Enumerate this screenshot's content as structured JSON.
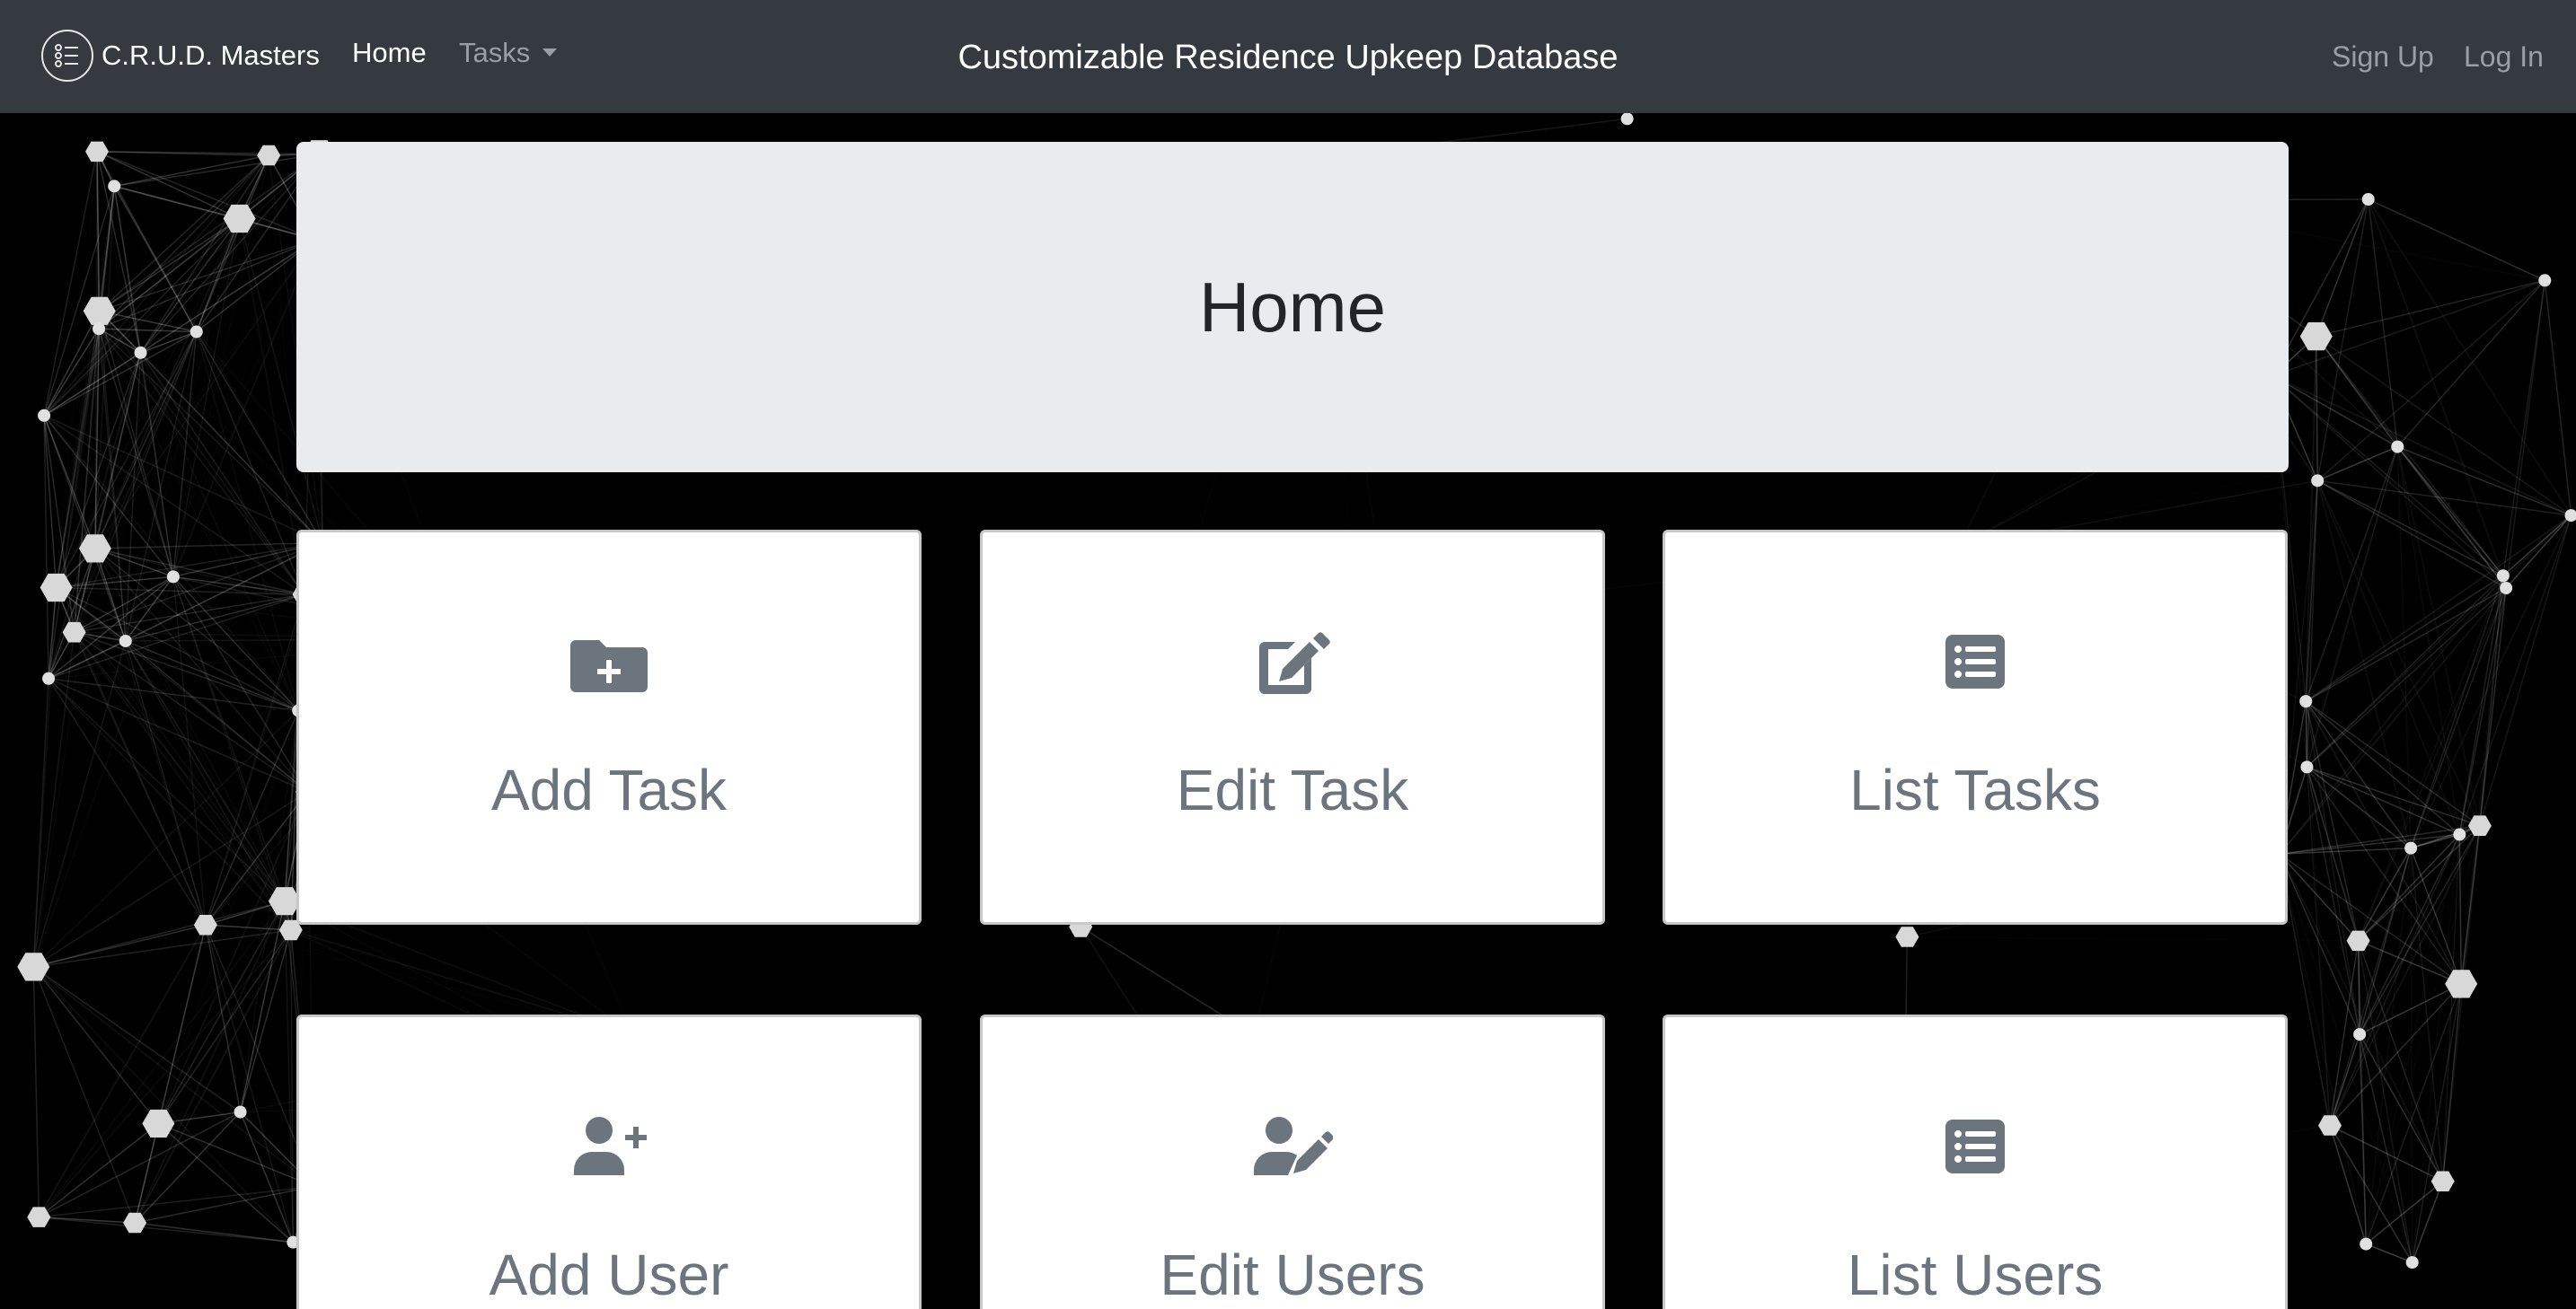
{
  "navbar": {
    "brand": "C.R.U.D. Masters",
    "brand_icon": "list-circle-icon",
    "home": "Home",
    "tasks": "Tasks",
    "title": "Customizable Residence Upkeep Database",
    "sign_up": "Sign Up",
    "log_in": "Log In"
  },
  "jumbotron": {
    "heading": "Home"
  },
  "cards": [
    {
      "label": "Add Task",
      "icon": "folder-plus-icon"
    },
    {
      "label": "Edit Task",
      "icon": "edit-icon"
    },
    {
      "label": "List Tasks",
      "icon": "list-alt-icon"
    },
    {
      "label": "Add User",
      "icon": "user-plus-icon"
    },
    {
      "label": "Edit Users",
      "icon": "user-edit-icon"
    },
    {
      "label": "List Users",
      "icon": "list-alt-icon"
    }
  ],
  "colors": {
    "navbar": "#343a40",
    "jumbotron": "#e9ecef",
    "card_text": "#6c757d",
    "background": "#000000"
  }
}
